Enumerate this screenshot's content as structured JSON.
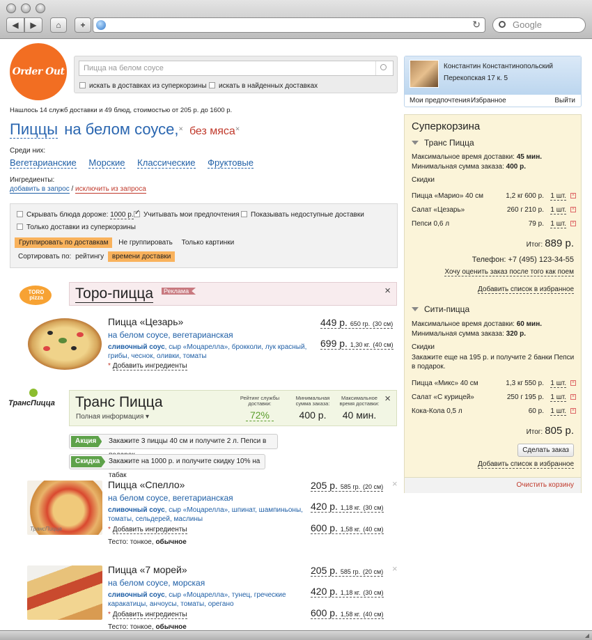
{
  "browser": {
    "back": "◀",
    "forward": "▶",
    "home": "⌂",
    "add": "+",
    "reload": "↻",
    "search_placeholder": "Google"
  },
  "header": {
    "logo": "Order Out",
    "search_placeholder": "Пицца на белом соусе",
    "opt1": "искать в доставках из суперкорзины",
    "opt2": "искать в найденных доставках"
  },
  "summary": "Нашлось 14 служб доставки и 49 блюд, стоимостью от 205 р. до 1600 р.",
  "query": {
    "w1": "Пиццы",
    "w2": "на белом соусе,",
    "w3": "без мяса"
  },
  "among": {
    "label": "Среди них:",
    "items": [
      "Вегетарианские",
      "Морские",
      "Классические",
      "Фруктовые"
    ]
  },
  "ingredients": {
    "label": "Ингредиенты:",
    "add": "добавить в запрос",
    "sep": "/",
    "exclude": "исключить из запроса"
  },
  "filters": {
    "hide_expensive_pre": "Скрывать блюда дороже:",
    "hide_expensive_val": "1000 р.",
    "consider_prefs": "Учитывать мои предпочтения",
    "show_unavailable": "Показывать недоступные доставки",
    "only_cart": "Только доставки из суперкорзины",
    "group_by": "Группировать по доставкам",
    "no_group": "Не группировать",
    "only_pics": "Только картинки",
    "sort_label": "Сортировать по:",
    "sort_rating": "рейтингу",
    "sort_time": "времени доставки"
  },
  "toro": {
    "logo": "TORO pizza",
    "name": "Торо-пицца",
    "ad": "Реклама",
    "close": "×",
    "item": {
      "name": "Пицца «Цезарь»",
      "sub": "на белом соусе, вегетарианская",
      "ingr1": "сливочный соус",
      "ingr_rest1": ", сыр «Моцарелла», брокколи, лук красный,",
      "ingr_rest2": "грибы, чеснок, оливки, томаты",
      "add": "Добавить ингредиенты",
      "prices": [
        {
          "p": "449 р.",
          "w": "650 гр.",
          "s": "(30 см)"
        },
        {
          "p": "699 р.",
          "w": "1,30 кг.",
          "s": "(40 см)"
        }
      ]
    }
  },
  "trans": {
    "logo": "ТрансПицца",
    "name": "Транс Пицца",
    "info": "Полная информация ▾",
    "close": "×",
    "rating_label": "Рейтинг службы доставки:",
    "rating": "72%",
    "min_label": "Минимальная сумма заказа:",
    "min": "400 р.",
    "max_label": "Максимальное время доставки:",
    "max": "40 мин.",
    "promo1_tag": "Акция",
    "promo1": "Закажите 3 пиццы 40 см и получите 2 л. Пепси в подарок",
    "promo2_tag": "Скидка",
    "promo2": "Закажите на 1000 р. и получите скидку 10% на табак",
    "items": [
      {
        "name": "Пицца «Спелло»",
        "sub": "на белом соусе, вегетарианская",
        "ingr_bold": "сливочный соус",
        "ingr1": ", сыр «Моцарелла», шпинат, шампиньоны,",
        "ingr2": "томаты, сельдерей, маслины",
        "add": "Добавить ингредиенты",
        "dough_label": "Тесто:",
        "dough1": "тонкое,",
        "dough2": "обычное",
        "wm": "ТрансПицца",
        "prices": [
          {
            "p": "205 р.",
            "w": "585 гр.",
            "s": "(20 см)"
          },
          {
            "p": "420 р.",
            "w": "1,18 кг.",
            "s": "(30 см)"
          },
          {
            "p": "600 р.",
            "w": "1,58 кг.",
            "s": "(40 см)"
          }
        ]
      },
      {
        "name": "Пицца «7 морей»",
        "sub": "на белом соусе, морская",
        "ingr_bold": "сливочный соус",
        "ingr1": ", сыр «Моцарелла», тунец, греческие",
        "ingr2": "каракатицы, анчоусы, томаты, орегано",
        "add": "Добавить ингредиенты",
        "dough_label": "Тесто:",
        "dough1": "тонкое,",
        "dough2": "обычное",
        "prices": [
          {
            "p": "205 р.",
            "w": "585 гр.",
            "s": "(20 см)"
          },
          {
            "p": "420 р.",
            "w": "1,18 кг.",
            "s": "(30 см)"
          },
          {
            "p": "600 р.",
            "w": "1,58 кг.",
            "s": "(40 см)"
          }
        ]
      }
    ]
  },
  "user": {
    "name": "Константин Константинопольский",
    "address": "Перекопская 17 к. 5",
    "prefs": "Мои предпочтения",
    "fav": "Избранное",
    "logout": "Выйти"
  },
  "cart": {
    "title": "Суперкорзина",
    "s1": {
      "name": "Транс Пицца",
      "max_label": "Максимальное время доставки:",
      "max": "45 мин.",
      "min_label": "Минимальная сумма заказа:",
      "min": "400 р.",
      "disc": "Скидки",
      "items": [
        {
          "n": "Пицца «Марио» 40 см",
          "w": "1,2 кг",
          "p": "600 р.",
          "q": "1 шт."
        },
        {
          "n": "Салат «Цезарь»",
          "w": "260 г",
          "p": "210 р.",
          "q": "1 шт."
        },
        {
          "n": "Пепси 0,6 л",
          "w": "",
          "p": "79 р.",
          "q": "1 шт."
        }
      ],
      "total_label": "Итог:",
      "total": "889 р.",
      "phone": "Телефон: +7 (495) 123-34-55",
      "rate": "Хочу оценить заказ после того как поем",
      "addfav": "Добавить список в избранное"
    },
    "s2": {
      "name": "Сити-пицца",
      "max_label": "Максимальное время доставки:",
      "max": "60 мин.",
      "min_label": "Минимальная сумма заказа:",
      "min": "320 р.",
      "disc": "Скидки",
      "note1": "Закажите еще на 195 р. и получите 2 банки Пепси",
      "note2": "в подарок.",
      "items": [
        {
          "n": "Пицца «Микс» 40 см",
          "w": "1,3 кг",
          "p": "550 р.",
          "q": "1 шт."
        },
        {
          "n": "Салат «С курицей»",
          "w": "250 г",
          "p": "195 р.",
          "q": "1 шт."
        },
        {
          "n": "Кока-Кола 0,5 л",
          "w": "",
          "p": "60 р.",
          "q": "1 шт."
        }
      ],
      "total_label": "Итог:",
      "total": "805 р.",
      "order": "Сделать заказ",
      "addfav": "Добавить список в избранное"
    },
    "clear": "Очистить корзину"
  }
}
